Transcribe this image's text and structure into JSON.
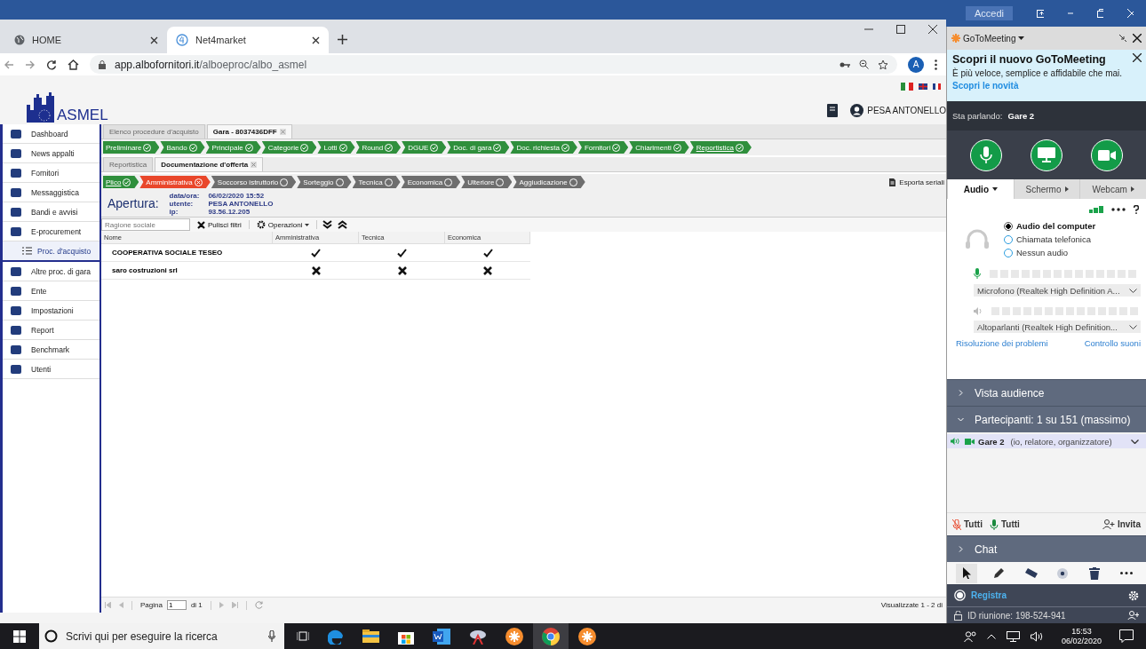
{
  "word_bar": {
    "signin": "Accedi"
  },
  "browser": {
    "tabs": [
      {
        "label": "HOME",
        "selected": false
      },
      {
        "label": "Net4market",
        "selected": true
      }
    ],
    "url_domain": "app.albofornitori.it",
    "url_path": "/alboeproc/albo_asmel",
    "avatar": "A"
  },
  "site": {
    "logo": "ASMEL",
    "user": "PESA ANTONELLO"
  },
  "sidebar": {
    "items": [
      {
        "label": "Dashboard",
        "selected": false
      },
      {
        "label": "News appalti",
        "selected": false
      },
      {
        "label": "Fornitori",
        "selected": false
      },
      {
        "label": "Messaggistica",
        "selected": false
      },
      {
        "label": "Bandi e avvisi",
        "selected": false
      },
      {
        "label": "E-procurement",
        "selected": false,
        "children": [
          {
            "label": "Proc. d'acquisto",
            "selected": true
          }
        ]
      },
      {
        "label": "Altre proc. di gara",
        "selected": false
      },
      {
        "label": "Ente",
        "selected": false
      },
      {
        "label": "Impostazioni",
        "selected": false
      },
      {
        "label": "Report",
        "selected": false
      },
      {
        "label": "Benchmark",
        "selected": false
      },
      {
        "label": "Utenti",
        "selected": false
      }
    ]
  },
  "main_tabs": [
    {
      "label": "Elenco procedure d'acquisto",
      "selected": false,
      "closable": false
    },
    {
      "label": "Gara - 8037436DFF",
      "selected": true,
      "closable": true
    }
  ],
  "steps": [
    {
      "label": "Preliminare",
      "checked": true,
      "selected": false
    },
    {
      "label": "Bando",
      "checked": true,
      "selected": false
    },
    {
      "label": "Principale",
      "checked": true,
      "selected": false
    },
    {
      "label": "Categorie",
      "checked": true,
      "selected": false
    },
    {
      "label": "Lotti",
      "checked": true,
      "selected": false
    },
    {
      "label": "Round",
      "checked": true,
      "selected": false
    },
    {
      "label": "DGUE",
      "checked": true,
      "selected": false
    },
    {
      "label": "Doc. di gara",
      "checked": true,
      "selected": false
    },
    {
      "label": "Doc. richiesta",
      "checked": true,
      "selected": false
    },
    {
      "label": "Fornitori",
      "checked": true,
      "selected": false
    },
    {
      "label": "Chiarimenti",
      "checked": true,
      "selected": false
    },
    {
      "label": "Reportistica",
      "checked": true,
      "selected": true
    }
  ],
  "sub_tabs": [
    {
      "label": "Reportistica",
      "selected": false,
      "closable": false
    },
    {
      "label": "Documentazione d'offerta",
      "selected": true,
      "closable": true
    }
  ],
  "phases": [
    {
      "label": "Plico",
      "checked": true,
      "failed": false,
      "selected": true
    },
    {
      "label": "Amministrativa",
      "checked": false,
      "failed": true,
      "selected": false
    },
    {
      "label": "Soccorso istruttorio",
      "checked": false,
      "failed": false,
      "selected": false
    },
    {
      "label": "Sorteggio",
      "checked": false,
      "failed": false,
      "selected": false
    },
    {
      "label": "Tecnica",
      "checked": false,
      "failed": false,
      "selected": false
    },
    {
      "label": "Economica",
      "checked": false,
      "failed": false,
      "selected": false
    },
    {
      "label": "Ulteriore",
      "checked": false,
      "failed": false,
      "selected": false
    },
    {
      "label": "Aggiudicazione",
      "checked": false,
      "failed": false,
      "selected": false
    }
  ],
  "export": "Esporta seriali",
  "opening": {
    "label": "Apertura:",
    "fields": [
      {
        "key": "data/ora:",
        "value": "06/02/2020 15:52"
      },
      {
        "key": "utente:",
        "value": "PESA ANTONELLO"
      },
      {
        "key": "ip:",
        "value": "93.56.12.205"
      }
    ]
  },
  "toolbar": {
    "placeholder": "Ragione sociale",
    "clear": "Pulisci filtri",
    "operations": "Operazioni"
  },
  "table": {
    "columns": [
      "Nome",
      "Amministrativa",
      "Tecnica",
      "Economica"
    ],
    "rows": [
      {
        "name": "COOPERATIVA SOCIALE TESEO",
        "checks": [
          true,
          true,
          true
        ]
      },
      {
        "name": "saro costruzioni srl",
        "checks": [
          false,
          false,
          false
        ]
      }
    ]
  },
  "pager": {
    "page_label": "Pagina",
    "page": "1",
    "of": "di 1",
    "summary": "Visualizzate 1 - 2 di"
  },
  "goto": {
    "title": "GoToMeeting",
    "promo": {
      "title": "Scopri il nuovo GoToMeeting",
      "text": "È più veloce, semplice e affidabile che mai.",
      "link": "Scopri le novità"
    },
    "speaking_label": "Sta parlando:",
    "speaker": "Gare 2",
    "tabs": [
      {
        "label": "Audio",
        "selected": true
      },
      {
        "label": "Schermo",
        "selected": false
      },
      {
        "label": "Webcam",
        "selected": false
      }
    ],
    "audio_options": [
      {
        "label": "Audio del computer",
        "selected": true
      },
      {
        "label": "Chiamata telefonica",
        "selected": false
      },
      {
        "label": "Nessun audio",
        "selected": false
      }
    ],
    "mic_meter": {
      "level": 0
    },
    "microphone": "Microfono (Realtek High Definition A...",
    "speaker_meter": {
      "level": 0
    },
    "speakers": "Altoparlanti (Realtek High Definition...",
    "links": [
      "Risoluzione dei problemi",
      "Controllo suoni"
    ],
    "sections": [
      {
        "label": "Vista audience",
        "expanded": false
      },
      {
        "label": "Partecipanti:  1 su 151 (massimo)",
        "expanded": true
      }
    ],
    "participants": [
      {
        "name": "Gare 2",
        "role": "(io, relatore, organizzatore)"
      }
    ],
    "mute_all": "Tutti",
    "unmute_all": "Tutti",
    "invite": "Invita",
    "chat": {
      "label": "Chat",
      "expanded": false
    },
    "tools": [
      {
        "selected": true
      },
      {
        "selected": false
      },
      {
        "selected": false
      },
      {
        "selected": false
      },
      {
        "selected": false
      },
      {
        "selected": false
      }
    ],
    "record": "Registra",
    "meeting_id": "ID riunione: 198-524-941"
  },
  "taskbar": {
    "search_placeholder": "Scrivi qui per eseguire la ricerca",
    "time": "15:53",
    "date": "06/02/2020"
  }
}
